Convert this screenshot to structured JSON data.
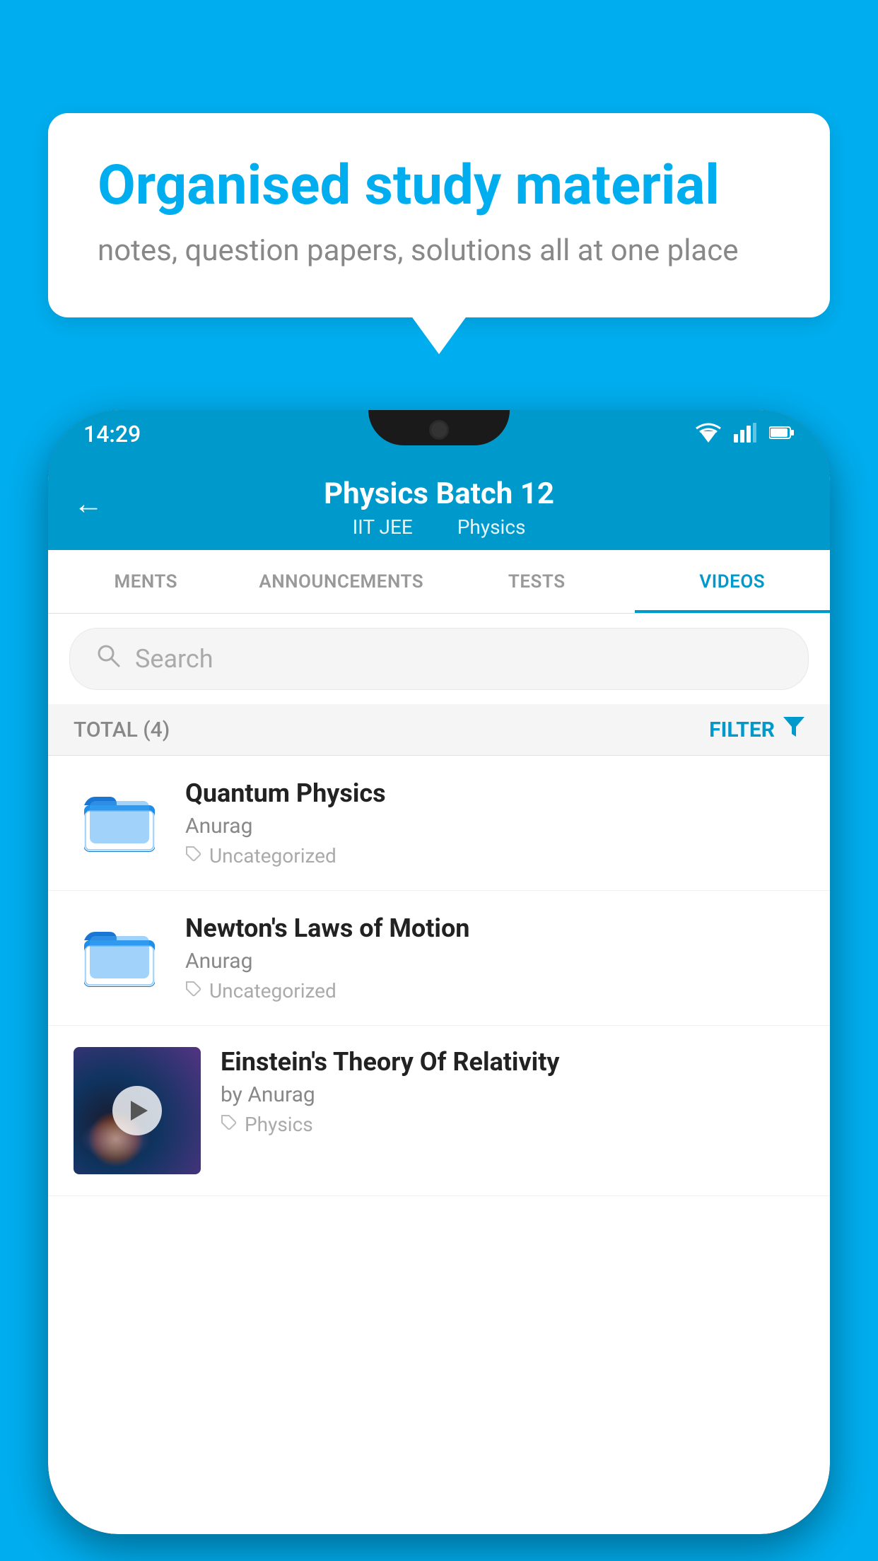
{
  "background_color": "#00AEEF",
  "bubble": {
    "title": "Organised study material",
    "subtitle": "notes, question papers, solutions all at one place"
  },
  "status_bar": {
    "time": "14:29",
    "wifi": "▼▲",
    "battery": "▮"
  },
  "app_header": {
    "back_label": "←",
    "title": "Physics Batch 12",
    "subtitle_part1": "IIT JEE",
    "subtitle_part2": "Physics"
  },
  "tabs": [
    {
      "label": "MENTS",
      "active": false
    },
    {
      "label": "ANNOUNCEMENTS",
      "active": false
    },
    {
      "label": "TESTS",
      "active": false
    },
    {
      "label": "VIDEOS",
      "active": true
    }
  ],
  "search": {
    "placeholder": "Search"
  },
  "filter_bar": {
    "total_label": "TOTAL (4)",
    "filter_label": "FILTER"
  },
  "videos": [
    {
      "title": "Quantum Physics",
      "author": "Anurag",
      "tag": "Uncategorized",
      "type": "folder"
    },
    {
      "title": "Newton's Laws of Motion",
      "author": "Anurag",
      "tag": "Uncategorized",
      "type": "folder"
    },
    {
      "title": "Einstein's Theory Of Relativity",
      "author": "by Anurag",
      "tag": "Physics",
      "type": "video"
    }
  ]
}
